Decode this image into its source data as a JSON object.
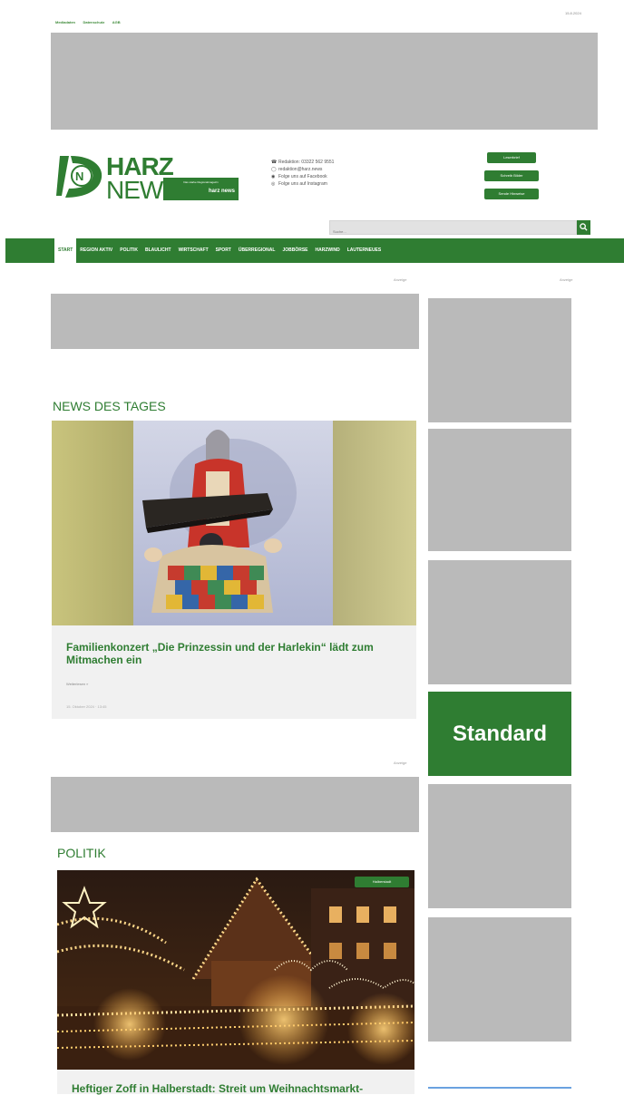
{
  "topbar": {
    "links": [
      "Mediadaten",
      "Datenschutz",
      "AGB"
    ],
    "date": "15.8.2024"
  },
  "logo": {
    "harz": "HARZ",
    "news": "NEWS",
    "badge_top": "Das starke Regionalmagazin",
    "badge_bottom": "harz news"
  },
  "contact": [
    {
      "icon": "phone-icon",
      "text": "Redaktion: 03322 562 9551"
    },
    {
      "icon": "whatsapp-icon",
      "text": "redaktion@harz.news"
    },
    {
      "icon": "facebook-icon",
      "text": "Folge uns auf Facebook"
    },
    {
      "icon": "instagram-icon",
      "text": "Folge uns auf Instagram"
    }
  ],
  "header_buttons": [
    "Leserbrief",
    "Schreib Bilder",
    "Sende Hinweise"
  ],
  "search": {
    "placeholder": "Suche..."
  },
  "nav": {
    "items": [
      "START",
      "REGION AKTIV",
      "POLITIK",
      "BLAULICHT",
      "WIRTSCHAFT",
      "SPORT",
      "ÜBERREGIONAL",
      "JOBBÖRSE",
      "HARZWIND",
      "LAUTERNEUES"
    ]
  },
  "ads": {
    "label": "Anzeige"
  },
  "sidebar": {
    "standard_label": "Standard"
  },
  "news_des_tages": {
    "title": "NEWS DES TAGES",
    "article": {
      "title": "Familienkonzert „Die Prinzessin und der Harlekin“ lädt zum Mitmachen ein",
      "read_more": "Weiterlesen »",
      "meta": "15. Oktober 2024 · 13:45"
    }
  },
  "politik": {
    "title": "POLITIK",
    "tag": "Halberstadt",
    "article_title": "Heftiger Zoff in Halberstadt: Streit um Weihnachtsmarkt-"
  }
}
